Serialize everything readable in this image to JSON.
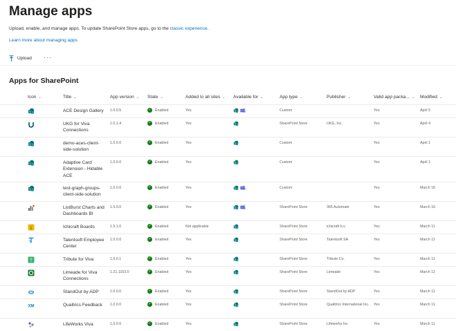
{
  "page": {
    "title": "Manage apps",
    "description_prefix": "Upload, enable, and manage apps. To update SharePoint Store apps, go to the ",
    "classic_link": "classic experience",
    "description_suffix": ".",
    "learn_more": "Learn more about managing apps"
  },
  "toolbar": {
    "upload_label": "Upload",
    "more_label": "···"
  },
  "section_title": "Apps for SharePoint",
  "columns": {
    "icon": "Icon",
    "title": "Title",
    "version": "App version",
    "state": "State",
    "added": "Added to all sites",
    "available": "Available for",
    "type": "App type",
    "publisher": "Publisher",
    "valid": "Valid app packa...",
    "modified": "Modified"
  },
  "colors": {
    "accent": "#0f6cbd",
    "enabled": "#107c10",
    "teams": "#5b5fc7",
    "sharepoint": "#036c70"
  },
  "rows": [
    {
      "icon": "sharepoint-app-icon",
      "title": "ACE Design Gallery",
      "version": "1.0.0.5",
      "state": "Enabled",
      "added": "Yes",
      "teams": true,
      "type": "Custom",
      "publisher": "",
      "valid": "Yes",
      "modified": "April 5"
    },
    {
      "icon": "ukg-logo-icon",
      "title": "UKG for Viva Connections",
      "version": "1.0.1.4",
      "state": "Enabled",
      "added": "Yes",
      "teams": false,
      "type": "SharePoint Store",
      "publisher": "UKG, Inc.",
      "valid": "Yes",
      "modified": "April 4"
    },
    {
      "icon": "sharepoint-app-icon",
      "title": "demo-aces-client-side-solution",
      "version": "1.0.0.0",
      "state": "Enabled",
      "added": "Yes",
      "teams": false,
      "type": "Custom",
      "publisher": "",
      "valid": "Yes",
      "modified": "April 1"
    },
    {
      "icon": "sharepoint-app-icon",
      "title": "Adaptive Card Extension - Hidable ACE",
      "version": "1.0.0.0",
      "state": "Enabled",
      "added": "Yes",
      "teams": false,
      "type": "Custom",
      "publisher": "",
      "valid": "Yes",
      "modified": "April 1"
    },
    {
      "icon": "sharepoint-app-icon",
      "title": "test-graph-groups-client-side-solution",
      "version": "1.0.0.0",
      "state": "Enabled",
      "added": "Yes",
      "teams": true,
      "type": "Custom",
      "publisher": "",
      "valid": "Yes",
      "modified": "March 16"
    },
    {
      "icon": "listburst-logo-icon",
      "title": "ListBurst Charts and Dashboards BI",
      "version": "1.5.0.0",
      "state": "Enabled",
      "added": "Yes",
      "teams": true,
      "type": "SharePoint Store",
      "publisher": "365 Automate",
      "valid": "Yes",
      "modified": "March 16"
    },
    {
      "icon": "ichicraft-logo-icon",
      "title": "Ichicraft Boards",
      "version": "1.5.1.0",
      "state": "Enabled",
      "added": "Not applicable",
      "teams": false,
      "type": "SharePoint Store",
      "publisher": "ichicraft b.v.",
      "valid": "Yes",
      "modified": "March 11"
    },
    {
      "icon": "talentsoft-logo-icon",
      "title": "Talentsoft Employee Center",
      "version": "1.0.0.0",
      "state": "Enabled",
      "added": "Yes",
      "teams": false,
      "type": "SharePoint Store",
      "publisher": "Talentsoft SA",
      "valid": "Yes",
      "modified": "March 11"
    },
    {
      "icon": "tribute-logo-icon",
      "title": "Tribute for Viva",
      "version": "1.0.0.1",
      "state": "Enabled",
      "added": "Yes",
      "teams": false,
      "type": "SharePoint Store",
      "publisher": "Tribute Co.",
      "valid": "Yes",
      "modified": "March 11"
    },
    {
      "icon": "limeade-logo-icon",
      "title": "Limeade for Viva Connections",
      "version": "1.21.1103.0",
      "state": "Enabled",
      "added": "Yes",
      "teams": false,
      "type": "SharePoint Store",
      "publisher": "Limeade",
      "valid": "Yes",
      "modified": "March 11"
    },
    {
      "icon": "adp-logo-icon",
      "title": "StandOut by ADP",
      "version": "1.0.0.0",
      "state": "Enabled",
      "added": "Yes",
      "teams": false,
      "type": "SharePoint Store",
      "publisher": "StandOut by ADP",
      "valid": "Yes",
      "modified": "March 11"
    },
    {
      "icon": "qualtrics-xm-icon",
      "title": "Qualtrics Feedback",
      "version": "1.0.0.0",
      "state": "Enabled",
      "added": "Yes",
      "teams": false,
      "type": "SharePoint Store",
      "publisher": "Qualtrics International Inc.",
      "valid": "Yes",
      "modified": "March 11"
    },
    {
      "icon": "lifeworks-logo-icon",
      "title": "LifeWorks Viva",
      "version": "1.0.0.0",
      "state": "Enabled",
      "added": "Yes",
      "teams": false,
      "type": "SharePoint Store",
      "publisher": "Lifeworks Inc",
      "valid": "Yes",
      "modified": "March 11"
    }
  ]
}
